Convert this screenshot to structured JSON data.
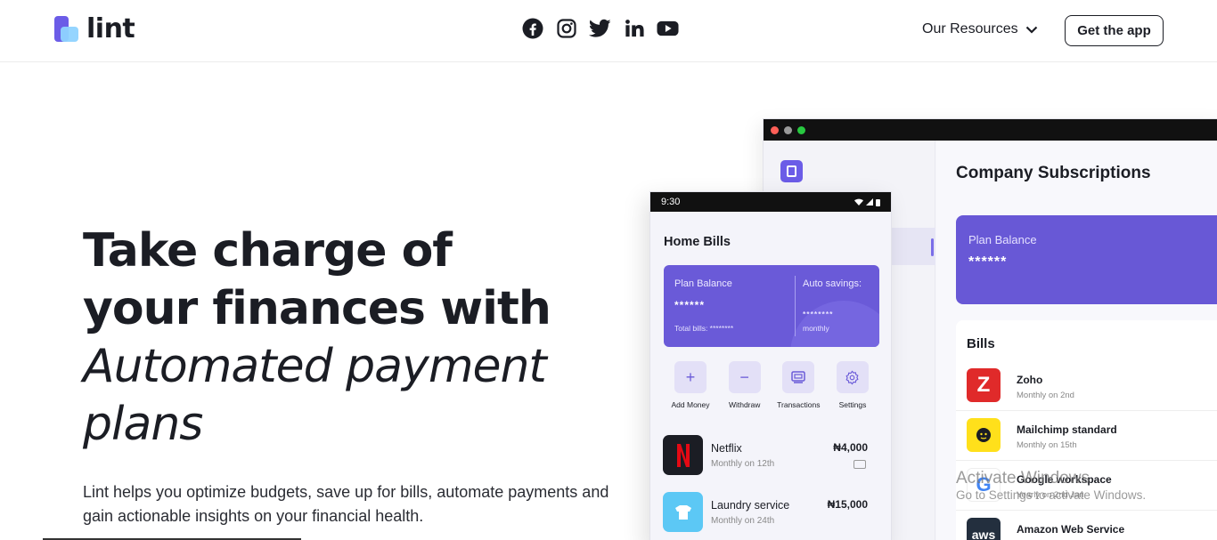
{
  "header": {
    "logo_text": "lint",
    "socials": [
      "facebook-icon",
      "instagram-icon",
      "twitter-icon",
      "linkedin-icon",
      "youtube-icon"
    ],
    "resources_label": "Our Resources",
    "get_app_label": "Get the app"
  },
  "hero": {
    "title_line1": "Take charge of",
    "title_line2": "your finances with",
    "title_line3": "Automated payment",
    "title_line4": "plans",
    "subtitle": "Lint helps you optimize budgets, save up for bills, automate payments and gain actionable insights on your financial health."
  },
  "desktop": {
    "title": "Company Subscriptions",
    "plan_balance_label": "Plan Balance",
    "plan_balance_value": "******",
    "bills_heading": "Bills",
    "bills": [
      {
        "name": "Zoho",
        "meta": "Monthly on 2nd",
        "icon": "Z",
        "color": "#e02a2a"
      },
      {
        "name": "Mailchimp standard",
        "meta": "Monthly on 15th",
        "icon": "mailchimp-icon",
        "color": "#ffe01b"
      },
      {
        "name": "Google workspace",
        "meta": "Yearly on 2nd Jan",
        "icon": "G",
        "color": "#ffffff"
      },
      {
        "name": "Amazon Web Service",
        "meta": "",
        "icon": "aws",
        "color": "#232f3e"
      }
    ]
  },
  "phone": {
    "time": "9:30",
    "title": "Home Bills",
    "plan_balance_label": "Plan Balance",
    "plan_balance_value": "******",
    "total_bills": "Total bills: ********",
    "auto_savings_label": "Auto savings:",
    "auto_savings_value": "********",
    "auto_savings_period": "monthly",
    "actions": [
      "Add Money",
      "Withdraw",
      "Transactions",
      "Settings"
    ],
    "bills": [
      {
        "name": "Netflix",
        "meta": "Monthly on 12th",
        "amount": "₦4,000"
      },
      {
        "name": "Laundry service",
        "meta": "Monthly on 24th",
        "amount": "₦15,000"
      }
    ]
  },
  "watermark": {
    "line1": "Activate Windows",
    "line2": "Go to Settings to activate Windows."
  },
  "colors": {
    "brand_purple": "#6858d6",
    "light_purple": "#e3e0f7",
    "text_dark": "#1b1d24"
  }
}
